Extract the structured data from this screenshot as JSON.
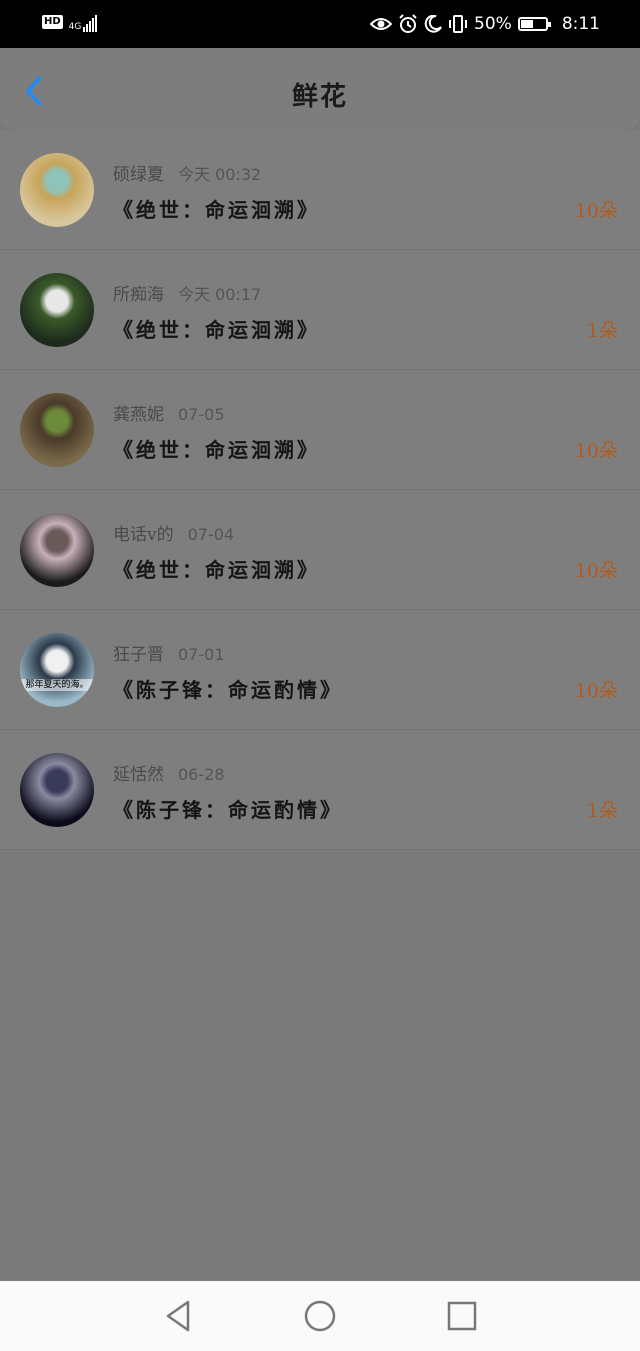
{
  "status_bar": {
    "hd": "HD",
    "network": "4G",
    "battery_percent": "50%",
    "battery_level": 0.5,
    "time": "8:11"
  },
  "header": {
    "title": "鲜花",
    "back_icon": "chevron-left-icon"
  },
  "records": [
    {
      "user": "硕绿夏",
      "time": "今天 00:32",
      "book": "《绝世：命运洄溯》",
      "count": "10朵",
      "avatar_colors": [
        "#d8c79e",
        "#8fc3b9",
        "#c8a45a"
      ]
    },
    {
      "user": "所痴海",
      "time": "今天 00:17",
      "book": "《绝世：命运洄溯》",
      "count": "1朵",
      "avatar_colors": [
        "#1d2a1d",
        "#e8e8e8",
        "#3a5a2a"
      ]
    },
    {
      "user": "龚燕妮",
      "time": "07-05",
      "book": "《绝世：命运洄溯》",
      "count": "10朵",
      "avatar_colors": [
        "#7a6a4a",
        "#6b8a3a",
        "#4a3a2a"
      ]
    },
    {
      "user": "电话v的",
      "time": "07-04",
      "book": "《绝世：命运洄溯》",
      "count": "10朵",
      "avatar_colors": [
        "#1a1a1a",
        "#6a5a5a",
        "#c8b0b8"
      ]
    },
    {
      "user": "狂子晋",
      "time": "07-01",
      "book": "《陈子锋：命运酌情》",
      "count": "10朵",
      "avatar_colors": [
        "#9ab8c8",
        "#f0f0f0",
        "#2a3a4a"
      ],
      "avatar_caption": "那年夏天的海。"
    },
    {
      "user": "延恬然",
      "time": "06-28",
      "book": "《陈子锋：命运酌情》",
      "count": "1朵",
      "avatar_colors": [
        "#0a0a1a",
        "#3a3a5a",
        "#8a8aa0"
      ]
    }
  ],
  "colors": {
    "accent": "#1a8cff",
    "count": "#b25a1d"
  },
  "nav": {
    "back_icon": "triangle-back-icon",
    "home_icon": "circle-home-icon",
    "recents_icon": "square-recents-icon"
  }
}
